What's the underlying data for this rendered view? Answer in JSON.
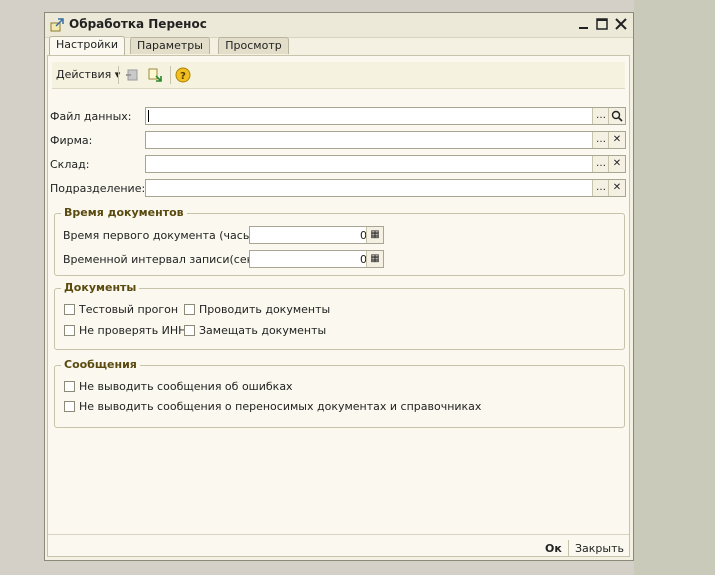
{
  "window": {
    "title": "Обработка  Перенос",
    "icon": "processing-icon",
    "controls": [
      "minimize-icon",
      "maximize-icon",
      "close-icon"
    ]
  },
  "tabs": [
    {
      "label": "Настройки",
      "active": true
    },
    {
      "label": "Параметры",
      "active": false
    },
    {
      "label": "Просмотр",
      "active": false
    }
  ],
  "toolbar": {
    "actions_label": "Действия",
    "icons": [
      "upload-icon",
      "download-icon",
      "help-icon"
    ]
  },
  "fields": {
    "data_file": {
      "label": "Файл данных:",
      "value": ""
    },
    "firm": {
      "label": "Фирма:",
      "value": ""
    },
    "warehouse": {
      "label": "Склад:",
      "value": ""
    },
    "division": {
      "label": "Подразделение:",
      "value": ""
    }
  },
  "time_group": {
    "title": "Время документов",
    "first_doc_label": "Время первого документа (часы):",
    "first_doc_value": "0",
    "interval_label": "Временной интервал записи(сек):",
    "interval_value": "0"
  },
  "docs_group": {
    "title": "Документы",
    "test_run": "Тестовый прогон",
    "post_docs": "Проводить документы",
    "no_inn_check": "Не проверять ИНН",
    "replace_docs": "Замещать документы"
  },
  "messages_group": {
    "title": "Сообщения",
    "no_errors": "Не выводить сообщения об ошибках",
    "no_transfer_msgs": "Не выводить сообщения о переносимых документах и справочниках"
  },
  "buttons": {
    "ok": "Ок",
    "close": "Закрыть"
  },
  "colors": {
    "accent_group_title": "#5a4a10",
    "panel_bg": "#fbf9ef",
    "desktop_bg": "#d4d0c8"
  }
}
